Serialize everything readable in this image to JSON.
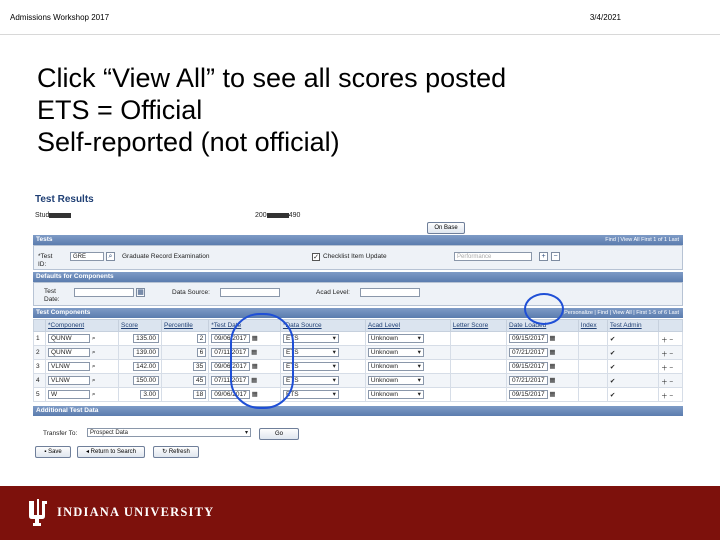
{
  "slide": {
    "header_left": "Admissions Workshop 2017",
    "header_right": "3/4/2021",
    "bullets": [
      "Click “View All” to see all scores posted",
      "ETS = Official",
      "Self-reported (not official)"
    ]
  },
  "screenshot": {
    "title": "Test Results",
    "student_label": "Stud",
    "student_id_prefix": "200",
    "student_id_suffix": "490",
    "onbase_button": "On Base",
    "tests_bar": "Tests",
    "tests_tools": "Find | View All  First  1 of 1  Last",
    "test_id_label": "*Test ID:",
    "test_id_value": "GRE",
    "test_description": "Graduate Record Examination",
    "checklist_label": "Checklist Item Update",
    "checklist_extra": "Performance",
    "defaults_bar": "Defaults for Components",
    "test_date_label": "Test Date:",
    "data_source_label": "Data Source:",
    "acad_level_label": "Acad Level:",
    "components_bar": "Test Components",
    "components_tools": "Personalize | Find | View All |   First  1-5 of 6  Last",
    "columns": [
      "*Component",
      "Score",
      "Percentile",
      "*Test Date",
      "*Data Source",
      "Acad Level",
      "Letter Score",
      "Date Loaded",
      "Index",
      "Test Admin"
    ],
    "rows": [
      {
        "n": "1",
        "component": "QUNW",
        "score": "135.00",
        "pct": "2",
        "date": "09/06/2017",
        "source": "ETS",
        "level": "Unknown",
        "loaded": "09/15/2017"
      },
      {
        "n": "2",
        "component": "QUNW",
        "score": "139.00",
        "pct": "6",
        "date": "07/11/2017",
        "source": "ETS",
        "level": "Unknown",
        "loaded": "07/21/2017"
      },
      {
        "n": "3",
        "component": "VLNW",
        "score": "142.00",
        "pct": "35",
        "date": "09/06/2017",
        "source": "ETS",
        "level": "Unknown",
        "loaded": "09/15/2017"
      },
      {
        "n": "4",
        "component": "VLNW",
        "score": "150.00",
        "pct": "45",
        "date": "07/11/2017",
        "source": "ETS",
        "level": "Unknown",
        "loaded": "07/21/2017"
      },
      {
        "n": "5",
        "component": "W",
        "score": "3.00",
        "pct": "18",
        "date": "09/06/2017",
        "source": "ETS",
        "level": "Unknown",
        "loaded": "09/15/2017"
      }
    ],
    "additional_bar": "Additional Test Data",
    "transfer_label": "Transfer To:",
    "transfer_value": "Prospect Data",
    "go_button": "Go",
    "save_button": "Save",
    "return_button": "Return to Search",
    "refresh_button": "Refresh"
  },
  "footer": {
    "university": "INDIANA UNIVERSITY",
    "logo_icon": "iu-trident-icon",
    "color": "#7d110c"
  },
  "annotation_color": "#1f4fd6"
}
